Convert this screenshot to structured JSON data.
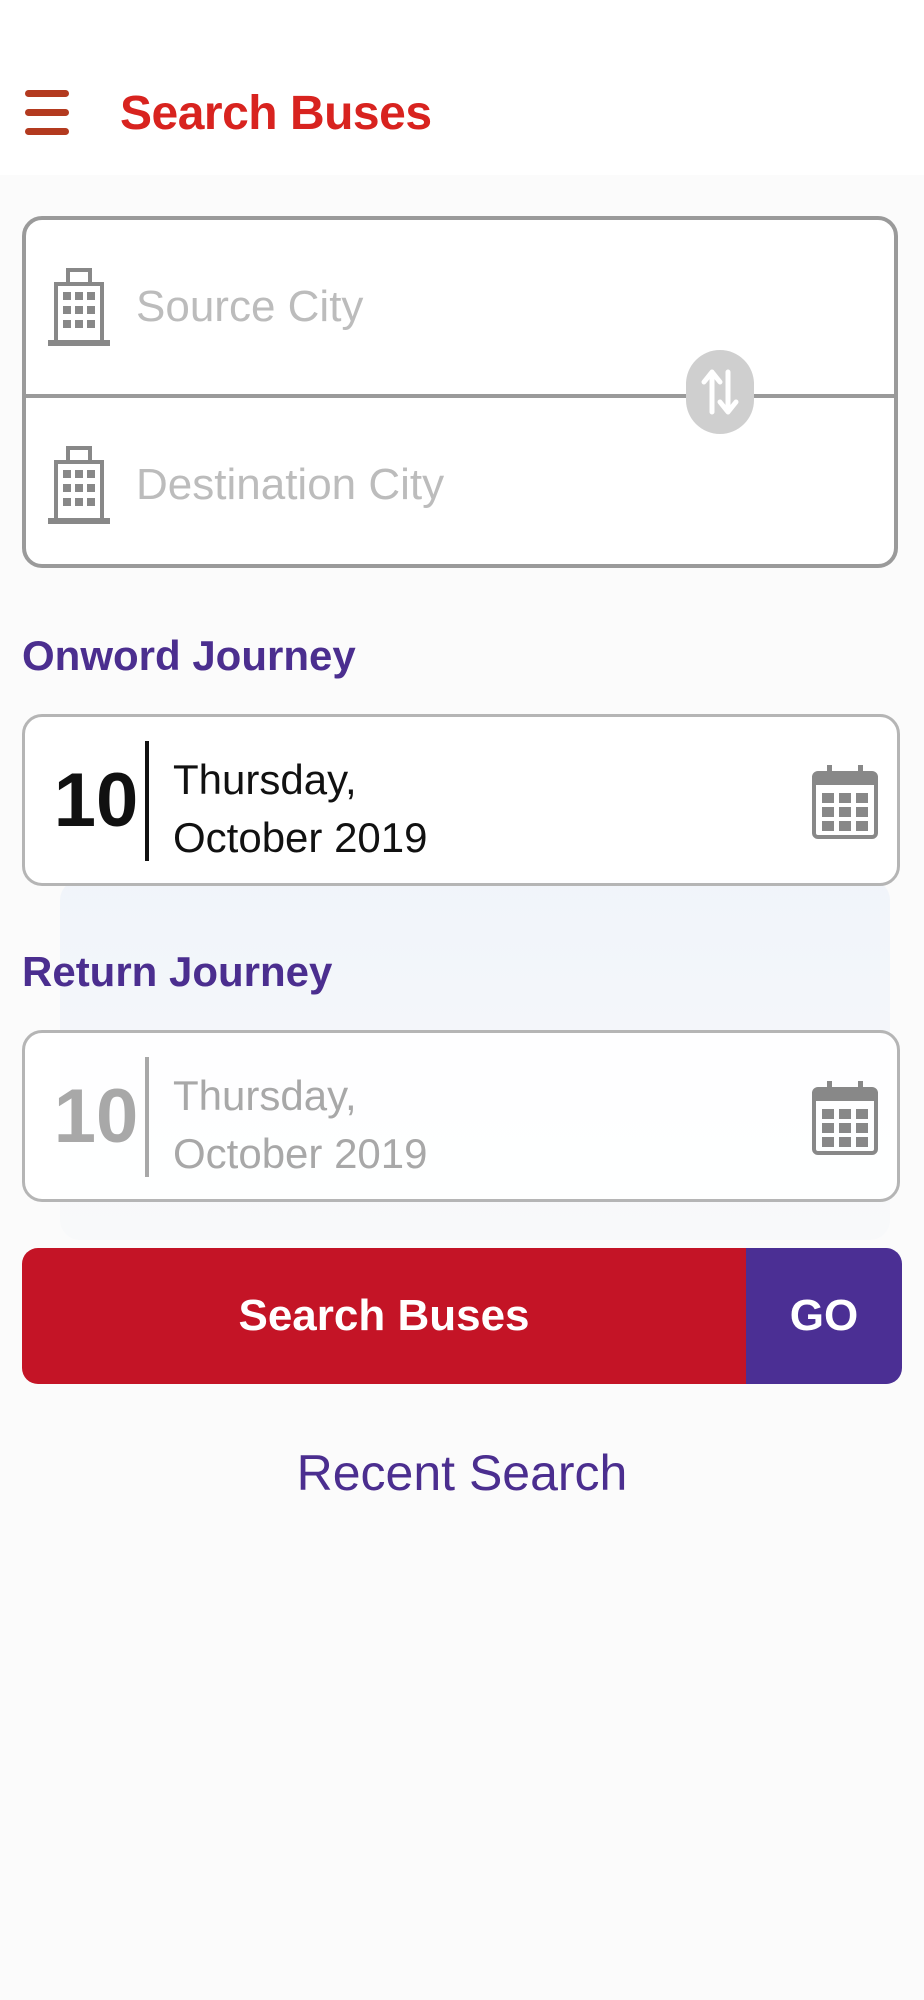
{
  "header": {
    "title": "Search Buses",
    "menu_icon": "hamburger-menu-icon",
    "accent_color": "#d8231f"
  },
  "search": {
    "source_placeholder": "Source City",
    "destination_placeholder": "Destination City",
    "source_icon": "building-icon",
    "destination_icon": "building-icon",
    "swap_icon": "swap-arrows-icon"
  },
  "onward": {
    "label": "Onword Journey",
    "day": "10",
    "weekday": "Thursday,",
    "month_year": "October 2019",
    "icon": "calendar-icon"
  },
  "return": {
    "label": "Return Journey",
    "day": "10",
    "weekday": "Thursday,",
    "month_year": "October 2019",
    "icon": "calendar-icon"
  },
  "actions": {
    "search_label": "Search Buses",
    "go_label": "GO",
    "recent_label": "Recent Search",
    "search_color": "#c41426",
    "go_color": "#4b2f94"
  }
}
